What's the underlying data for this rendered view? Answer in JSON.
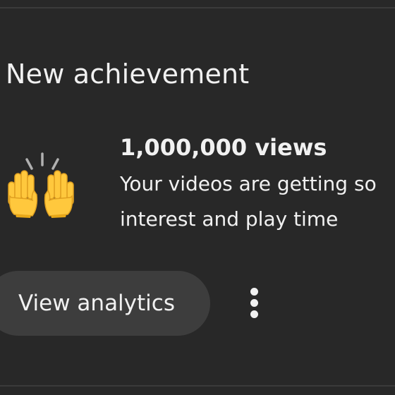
{
  "notification": {
    "section_title": "New achievement",
    "icon": "raising-hands-icon",
    "headline": "1,000,000 views",
    "description_line1": "Your videos are getting so",
    "description_line2": "interest and play time",
    "action_label": "View analytics",
    "more_icon": "more-vertical-icon"
  },
  "colors": {
    "background": "#282828",
    "text": "#f1f1f1",
    "button": "#3d3d3d",
    "hands": "#ffc83d"
  }
}
